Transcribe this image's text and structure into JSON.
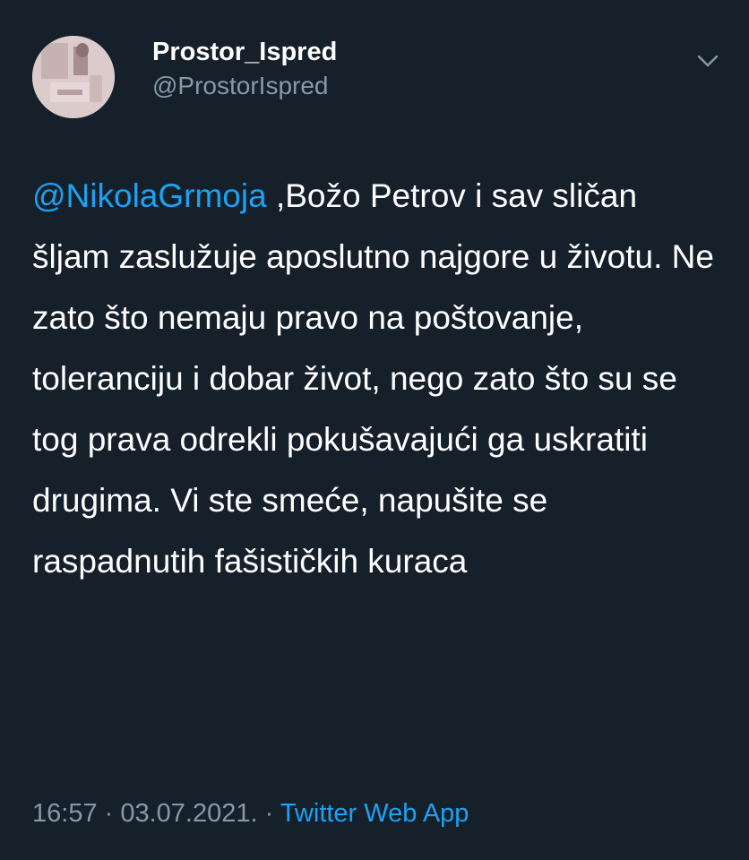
{
  "user": {
    "display_name": "Prostor_Ispred",
    "handle": "@ProstorIspred",
    "avatar_icon": "profile-photo",
    "menu_icon": "chevron-down-icon"
  },
  "tweet": {
    "mention": "@NikolaGrmoja",
    "text": " ,Božo Petrov i sav sličan šljam zaslužuje aposlutno najgore u životu. Ne zato što nemaju pravo na poštovanje, toleranciju i dobar život, nego zato što su se tog prava odrekli pokušavajući ga uskratiti drugima. Vi ste smeće, napušite se raspadnutih fašističkih kuraca"
  },
  "meta": {
    "time": "16:57",
    "separator": " · ",
    "date": "03.07.2021.",
    "source": "Twitter Web App"
  },
  "colors": {
    "background": "#15202b",
    "link": "#1da1f2",
    "secondary_text": "#8899a6",
    "primary_text": "#ffffff"
  }
}
